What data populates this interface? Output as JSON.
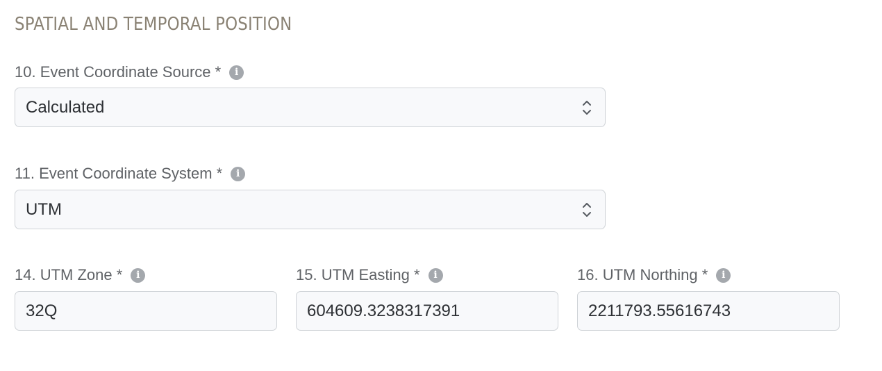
{
  "section": {
    "title": "SPATIAL AND TEMPORAL POSITION"
  },
  "fields": {
    "coordinate_source": {
      "label": "10. Event Coordinate Source *",
      "value": "Calculated"
    },
    "coordinate_system": {
      "label": "11. Event Coordinate System *",
      "value": "UTM"
    },
    "utm_zone": {
      "label": "14. UTM Zone *",
      "value": "32Q"
    },
    "utm_easting": {
      "label": "15. UTM Easting *",
      "value": "604609.3238317391"
    },
    "utm_northing": {
      "label": "16. UTM Northing *",
      "value": "2211793.55616743"
    }
  },
  "icons": {
    "info": "info-icon",
    "select": "chevron-up-down-icon"
  },
  "colors": {
    "section_title": "#8a8274",
    "label": "#5f6266",
    "input_border": "#cfd3d7",
    "input_background": "#f8f9fb",
    "info_icon": "#a4a8ad"
  }
}
